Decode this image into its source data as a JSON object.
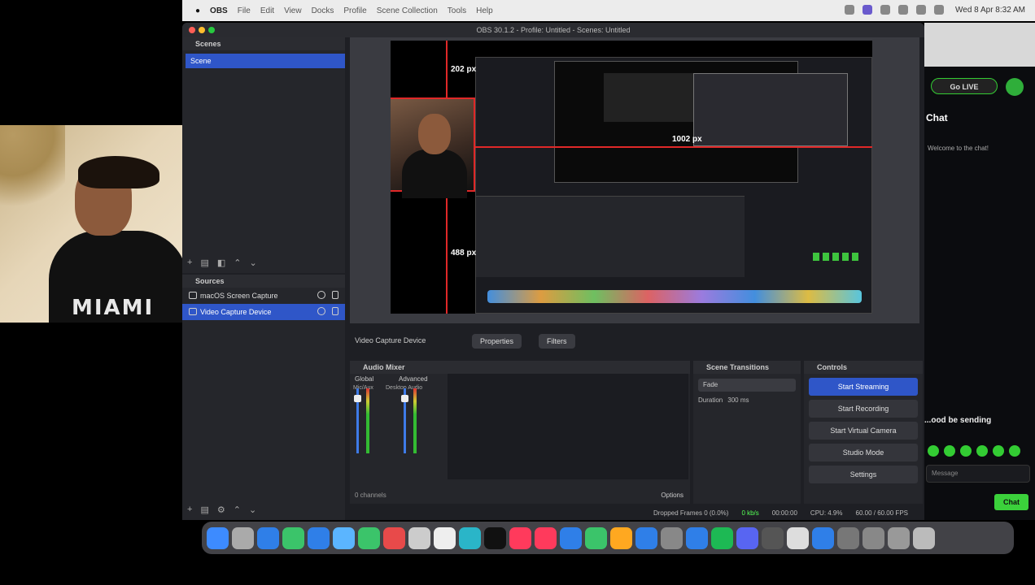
{
  "menubar": {
    "apple": "",
    "app_name": "OBS",
    "items": [
      "File",
      "Edit",
      "View",
      "Docks",
      "Profile",
      "Scene Collection",
      "Tools",
      "Help"
    ],
    "clock": "Wed 8 Apr 8:32 AM"
  },
  "obs": {
    "window_title": "OBS 30.1.2 - Profile: Untitled - Scenes: Untitled",
    "scenes": {
      "title": "Scenes",
      "items": [
        "Scene"
      ]
    },
    "sources": {
      "title": "Sources",
      "items": [
        {
          "label": "macOS Screen Capture",
          "selected": false
        },
        {
          "label": "Video Capture Device",
          "selected": true
        }
      ]
    },
    "preview": {
      "guide_top": "202 px",
      "guide_right": "1002 px",
      "guide_bottom": "488 px"
    },
    "source_toolbar": {
      "name": "Video Capture Device",
      "properties": "Properties",
      "filters": "Filters"
    },
    "audio_mixer": {
      "title": "Audio Mixer",
      "tab_a": "Global",
      "tab_b": "Advanced",
      "device": "Mic/Aux",
      "device2": "Desktop Audio",
      "footer": "0 channels",
      "options": "Options"
    },
    "transitions": {
      "title": "Scene Transitions",
      "selected": "Fade",
      "duration_label": "Duration",
      "duration_value": "300 ms"
    },
    "controls": {
      "title": "Controls",
      "start_streaming": "Start Streaming",
      "start_recording": "Start Recording",
      "virtual_camera": "Start Virtual Camera",
      "studio_mode": "Studio Mode",
      "settings": "Settings"
    },
    "status": {
      "dropped": "Dropped Frames 0 (0.0%)",
      "kbps": "0 kb/s",
      "time": "00:00:00",
      "cpu": "CPU: 4.9%",
      "fps": "60.00 / 60.00 FPS"
    }
  },
  "chat": {
    "go_button": "Go LIVE",
    "title": "Chat",
    "message": "Welcome to the chat!",
    "sending": "...ood be sending",
    "input_placeholder": "Message",
    "send_button": "Chat"
  },
  "colors": {
    "accent": "#2f56c8",
    "guide": "#e02828",
    "live": "#3bd13b"
  }
}
